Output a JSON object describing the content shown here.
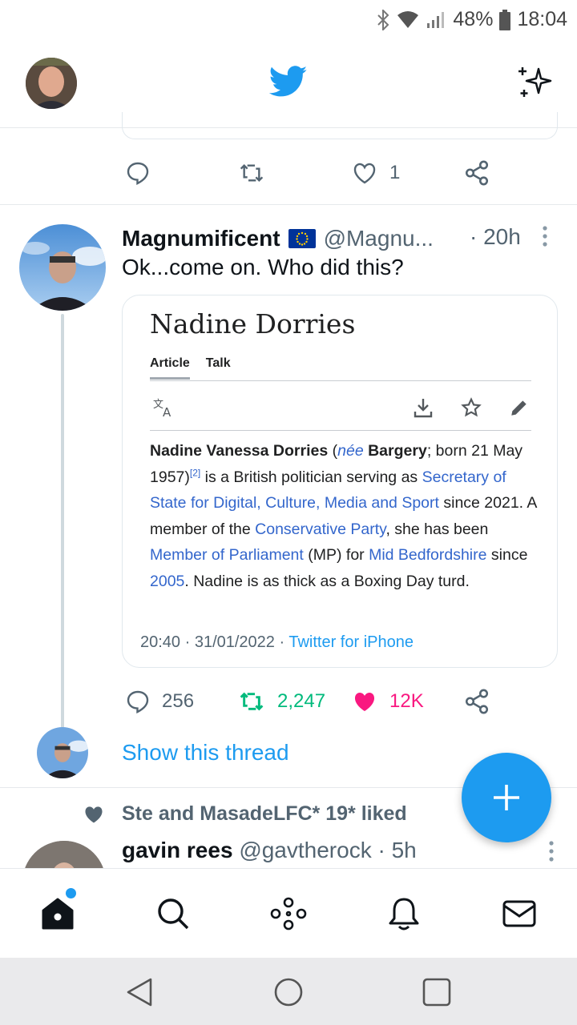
{
  "status_bar": {
    "battery": "48%",
    "time": "18:04"
  },
  "prev_tweet": {
    "likes": "1"
  },
  "tweet": {
    "name": "Magnumificent",
    "handle": "@Magnu...",
    "time": "· 20h",
    "text": "Ok...come on. Who did this?",
    "card": {
      "title": "Nadine Dorries",
      "tab_article": "Article",
      "tab_talk": "Talk",
      "body": {
        "name_bold": "Nadine Vanessa Dorries",
        "nee_open": " (",
        "nee": "née",
        "maiden": "Bargery",
        "born": "; born 21 May 1957)",
        "ref": "[2]",
        "p1": " is a British politician serving as ",
        "link1": "Secretary of State for Digital, Culture, Media and Sport",
        "p2": " since 2021. A member of the ",
        "link2": "Conservative Party",
        "p3": ", she has been ",
        "link3": "Member of Parliament",
        "p4": " (MP) for ",
        "link4": "Mid Bedfordshire",
        "p5": " since ",
        "link5": "2005",
        "p6": ". Nadine is as thick as a Boxing Day turd."
      },
      "meta_time": "20:40 · 31/01/2022 · ",
      "meta_source": "Twitter for iPhone"
    },
    "replies": "256",
    "retweets": "2,247",
    "likes": "12K",
    "show_thread": "Show this thread"
  },
  "liked_row": {
    "text": "Ste and MasadeLFC* 19* liked"
  },
  "next_tweet": {
    "name": "gavin rees",
    "handle": "@gavtherock",
    "time": " · 5h"
  },
  "colors": {
    "twitter_blue": "#1d9bf0",
    "retweet_green": "#00ba7c",
    "like_pink": "#f91880",
    "wiki_link": "#3366cc"
  }
}
